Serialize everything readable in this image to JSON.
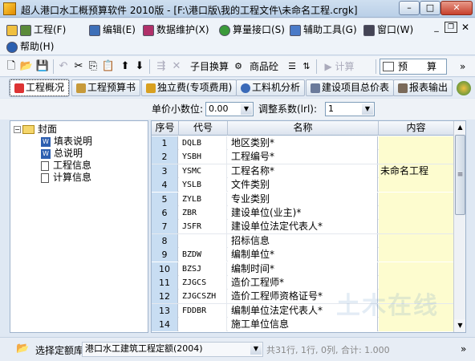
{
  "window": {
    "title": "超人港口水工概预算软件 2010版 - [F:\\港口版\\我的工程文件\\未命名工程.crgk]",
    "min": "–",
    "max": "□",
    "close": "✕"
  },
  "menu": {
    "items": [
      "工程(F)",
      "编辑(E)",
      "数据维护(X)",
      "算量接口(S)",
      "辅助工具(G)",
      "窗口(W)"
    ],
    "help": "帮助(H)",
    "mdi_min": "_",
    "mdi_restore": "❐",
    "mdi_close": "✕"
  },
  "toolbar": {
    "new": "🗋",
    "open": "📂",
    "save": "💾",
    "undo": "↶",
    "cut": "✂",
    "copy": "⎘",
    "paste": "📋",
    "up": "⬆",
    "down": "⬇",
    "insert": "⇶",
    "delete": "✕",
    "sub_calc": "子目换算",
    "material_check": "商品砼",
    "calc": "计算",
    "budget_mode": "预　　算",
    "more": "»"
  },
  "tabs": [
    "工程概况",
    "工程预算书",
    "独立费(专项费用)",
    "工料机分析",
    "建设项目总价表",
    "报表输出"
  ],
  "params": {
    "decimal_label": "单价小数位:",
    "decimal_value": "0.00",
    "coef_label": "调整系数(lrl):",
    "coef_value": "1"
  },
  "tree": {
    "root": "封面",
    "expander": "−",
    "children": [
      "填表说明",
      "总说明",
      "工程信息",
      "计算信息"
    ]
  },
  "grid": {
    "headers": [
      "序号",
      "代号",
      "名称",
      "内容"
    ],
    "rows": [
      {
        "no": "1",
        "code": "DQLB",
        "name": "地区类别*",
        "val": ""
      },
      {
        "no": "2",
        "code": "YSBH",
        "name": "工程编号*",
        "val": ""
      },
      {
        "no": "3",
        "code": "YSMC",
        "name": "工程名称*",
        "val": "未命名工程"
      },
      {
        "no": "4",
        "code": "YSLB",
        "name": "文件类别",
        "val": ""
      },
      {
        "no": "5",
        "code": "ZYLB",
        "name": "专业类别",
        "val": ""
      },
      {
        "no": "6",
        "code": "ZBR",
        "name": "建设单位(业主)*",
        "val": ""
      },
      {
        "no": "7",
        "code": "JSFR",
        "name": "建设单位法定代表人*",
        "val": ""
      },
      {
        "no": "8",
        "code": "",
        "name": "招标信息",
        "val": ""
      },
      {
        "no": "9",
        "code": "BZDW",
        "name": "编制单位*",
        "val": ""
      },
      {
        "no": "10",
        "code": "BZSJ",
        "name": "编制时间*",
        "val": ""
      },
      {
        "no": "11",
        "code": "ZJGCS",
        "name": "造价工程师*",
        "val": ""
      },
      {
        "no": "12",
        "code": "ZJGCSZH",
        "name": "造价工程师资格证号*",
        "val": ""
      },
      {
        "no": "13",
        "code": "FDDBR",
        "name": "编制单位法定代表人*",
        "val": ""
      },
      {
        "no": "14",
        "code": "",
        "name": "施工单位信息",
        "val": ""
      }
    ],
    "watermark": "土木在线"
  },
  "status": {
    "select_quota_label": "选择定额库",
    "quota_name": "港口水工建筑工程定额(2004)",
    "info": "共31行, 1行, 0列, 合计: 1.000"
  },
  "colors": {
    "row_number_bg": "#c8ddf2",
    "content_bg": "#fdfccf",
    "title_bg": "#b9cfe7"
  }
}
